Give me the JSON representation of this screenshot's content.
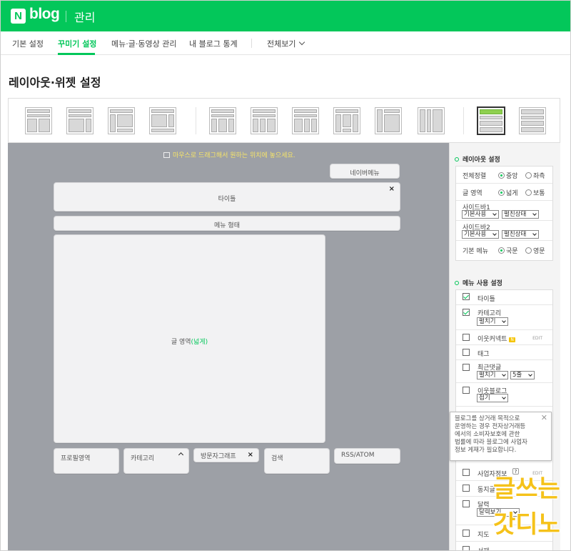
{
  "header": {
    "logo_mark": "N",
    "logo_text": "blog",
    "title": "관리"
  },
  "nav": {
    "items": [
      {
        "label": "기본 설정",
        "active": false
      },
      {
        "label": "꾸미기 설정",
        "active": true
      },
      {
        "label": "메뉴·글·동영상 관리",
        "active": false
      },
      {
        "label": "내 블로그 통계",
        "active": false
      }
    ],
    "all_view": "전체보기"
  },
  "page_title": "레이아웃·위젯 설정",
  "layout_selector": {
    "count": 12,
    "selected_index": 10
  },
  "canvas": {
    "hint": "마우스로 드래그해서 원하는 위치에 놓으세요.",
    "neighbor_menu": "네이버메뉴",
    "title_widget": "타이틀",
    "menu_widget": "메뉴 형태",
    "content_label": "글 영역",
    "content_suffix": "(넓게)",
    "bottom_widgets": [
      "프로필영역",
      "카테고리",
      "방문자그래프",
      "검색",
      "RSS/ATOM"
    ]
  },
  "layout_settings": {
    "title": "레이아웃 설정",
    "align": {
      "label": "전체정렬",
      "options": [
        "중앙",
        "좌측"
      ],
      "selected": "중앙"
    },
    "area": {
      "label": "글 영역",
      "options": [
        "넓게",
        "보통"
      ],
      "selected": "넓게"
    },
    "sidebar1": {
      "label": "사이드바1",
      "use": "기본사용",
      "state": "펼친상태"
    },
    "sidebar2": {
      "label": "사이드바2",
      "use": "기본사용",
      "state": "펼친상태"
    },
    "menu_lang": {
      "label": "기본 메뉴",
      "options": [
        "국문",
        "영문"
      ],
      "selected": "국문"
    }
  },
  "menu_settings": {
    "title": "메뉴 사용 설정",
    "items": [
      {
        "label": "타이틀",
        "checked": true
      },
      {
        "label": "카테고리",
        "checked": true,
        "select": "펼치기"
      },
      {
        "label": "이웃커넥트",
        "checked": false,
        "badge": "N",
        "edit": "EDIT"
      },
      {
        "label": "태그",
        "checked": false
      },
      {
        "label": "최근댓글",
        "checked": false,
        "select": "펼치기",
        "select2": "5줄"
      },
      {
        "label": "이웃블로그",
        "checked": false,
        "select": "접기"
      },
      {
        "label": "사업자정보",
        "checked": false,
        "edit": "EDIT"
      },
      {
        "label": "동지글",
        "checked": false
      },
      {
        "label": "달력",
        "checked": false,
        "select": "달력보기"
      },
      {
        "label": "지도",
        "checked": false
      },
      {
        "label": "서재",
        "checked": false
      }
    ],
    "help_mark": "?"
  },
  "tooltip": {
    "lines": [
      "블로그를 상거래 목적으로",
      "운영하는 경우 전자상거래등",
      "에서의 소비자보호에 관한",
      "법률에 따라 블로그에 사업자",
      "정보 게재가 필요합니다."
    ],
    "close": "✕"
  },
  "watermark": {
    "line1": "글쓰는",
    "line2": "갓디노"
  },
  "colors": {
    "brand": "#03c75a",
    "canvas": "#9da0a6",
    "hint": "#f5e36a",
    "watermark": "#f5c21a"
  }
}
